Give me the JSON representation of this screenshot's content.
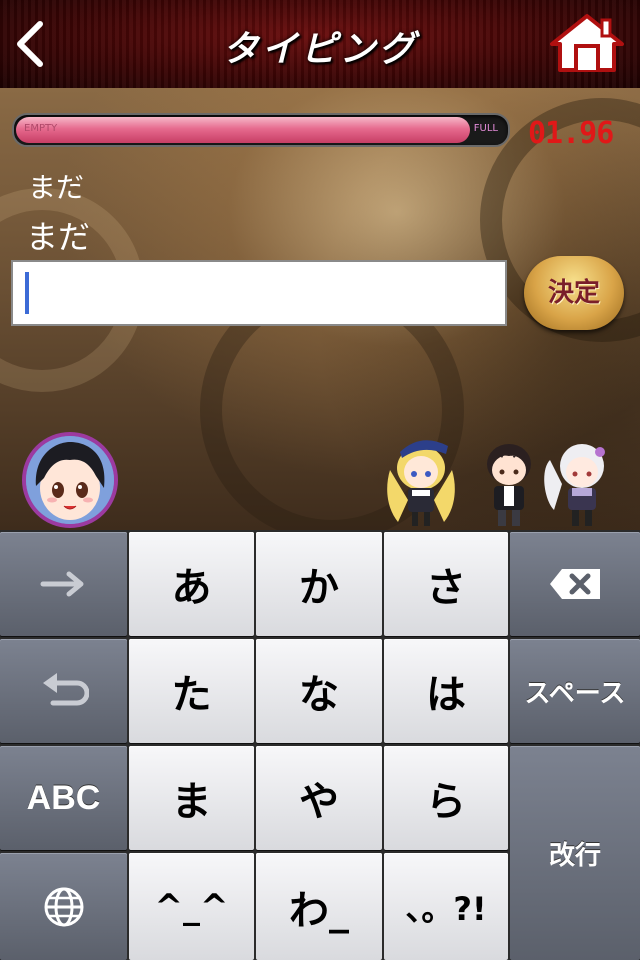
{
  "header": {
    "title": "タイピング",
    "back": "back",
    "home": "home"
  },
  "gauge": {
    "empty_label": "EMPTY",
    "full_label": "FULL",
    "level": 0.92,
    "color": "#e66a8e"
  },
  "timer": "01.96",
  "question": {
    "reading": "まだ",
    "text": "まだ"
  },
  "input": {
    "value": ""
  },
  "submit_label": "決定",
  "keyboard": {
    "rows": [
      [
        "あ",
        "か",
        "さ"
      ],
      [
        "た",
        "な",
        "は"
      ],
      [
        "ま",
        "や",
        "ら"
      ],
      [
        "^_^",
        "わ_",
        "、。?!"
      ]
    ],
    "left": {
      "arrow": "arrow-right-icon",
      "undo": "undo-icon",
      "abc": "ABC",
      "globe": "globe-icon"
    },
    "right": {
      "delete": "backspace-icon",
      "space": "スペース",
      "enter": "改行"
    }
  },
  "colors": {
    "timer": "#e01818",
    "caret": "#3c6bd6",
    "accent": "#9c3aa0"
  }
}
